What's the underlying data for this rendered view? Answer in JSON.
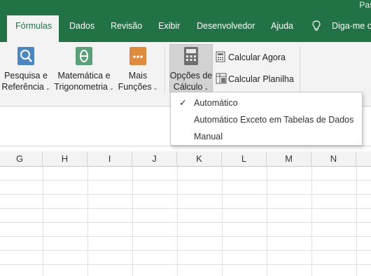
{
  "window": {
    "title_partial": "Pas"
  },
  "tabs": [
    {
      "label": "Fórmulas",
      "active": true
    },
    {
      "label": "Dados"
    },
    {
      "label": "Revisão"
    },
    {
      "label": "Exibir"
    },
    {
      "label": "Desenvolvedor"
    },
    {
      "label": "Ajuda"
    },
    {
      "label": "Diga-me o"
    }
  ],
  "ribbon": {
    "lookup": {
      "line1": "Pesquisa e",
      "line2": "Referência"
    },
    "math": {
      "line1": "Matemática e",
      "line2": "Trigonometria"
    },
    "more": {
      "line1": "Mais",
      "line2": "Funções"
    },
    "calc_options": {
      "line1": "Opções de",
      "line2": "Cálculo"
    },
    "calc_now": "Calcular Agora",
    "calc_sheet": "Calcular Planilha"
  },
  "menu": {
    "items": [
      {
        "label": "Automático",
        "checked": true
      },
      {
        "label": "Automático Exceto em Tabelas de Dados",
        "checked": false
      },
      {
        "label": "Manual",
        "checked": false
      }
    ]
  },
  "columns": [
    "G",
    "H",
    "I",
    "J",
    "K",
    "L",
    "M",
    "N"
  ],
  "colors": {
    "accent": "#217346",
    "selected": "#d2d2d2"
  }
}
